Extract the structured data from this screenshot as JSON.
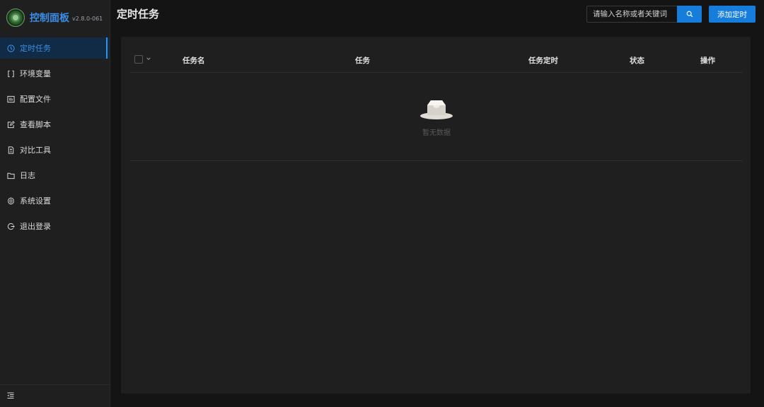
{
  "brand": {
    "title": "控制面板",
    "version": "v2.8.0-061"
  },
  "sidebar": {
    "items": [
      {
        "label": "定时任务",
        "icon": "clock-icon",
        "active": true
      },
      {
        "label": "环境变量",
        "icon": "brackets-icon",
        "active": false
      },
      {
        "label": "配置文件",
        "icon": "control-panel-icon",
        "active": false
      },
      {
        "label": "查看脚本",
        "icon": "edit-icon",
        "active": false
      },
      {
        "label": "对比工具",
        "icon": "diff-icon",
        "active": false
      },
      {
        "label": "日志",
        "icon": "folder-icon",
        "active": false
      },
      {
        "label": "系统设置",
        "icon": "gear-icon",
        "active": false
      },
      {
        "label": "退出登录",
        "icon": "logout-icon",
        "active": false
      }
    ],
    "collapse_icon": "menu-fold-icon"
  },
  "header": {
    "title": "定时任务",
    "search_placeholder": "请输入名称或者关键词",
    "add_label": "添加定时"
  },
  "table": {
    "columns": [
      "任务名",
      "任务",
      "任务定时",
      "状态",
      "操作"
    ],
    "empty_text": "暂无数据"
  },
  "colors": {
    "accent": "#177ddc",
    "active_text": "#3a8ee6",
    "background": "#141414",
    "panel": "#1f1f1f"
  }
}
